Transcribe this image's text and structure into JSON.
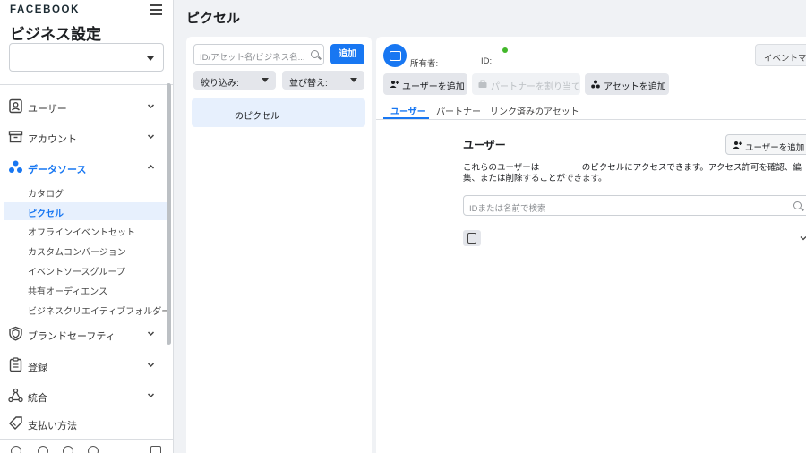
{
  "sidebar": {
    "brand": "FACEBOOK",
    "title": "ビジネス設定",
    "business_select_value": "",
    "items": [
      {
        "label": "ユーザー",
        "icon": "user-badge-icon"
      },
      {
        "label": "アカウント",
        "icon": "archive-box-icon"
      },
      {
        "label": "データソース",
        "icon": "nodes-icon"
      },
      {
        "label": "ブランドセーフティ",
        "icon": "shield-icon"
      },
      {
        "label": "登録",
        "icon": "clipboard-icon"
      },
      {
        "label": "統合",
        "icon": "integration-icon"
      },
      {
        "label": "支払い方法",
        "icon": "tag-icon"
      }
    ],
    "sub_items": [
      "カタログ",
      "ピクセル",
      "オフラインイベントセット",
      "カスタムコンバージョン",
      "イベントソースグループ",
      "共有オーディエンス",
      "ビジネスクリエイティブフォルダー"
    ]
  },
  "main": {
    "page_title": "ピクセル",
    "list": {
      "search_placeholder": "ID/アセット名/ビジネス名...",
      "add_button": "追加",
      "filter_label": "絞り込み:",
      "sort_label": "並び替え:",
      "items": [
        "のピクセル"
      ]
    },
    "detail": {
      "owner_label": "所有者:",
      "id_label": "ID:",
      "event_button": "イベントマ",
      "add_user_button": "ユーザーを追加",
      "assign_partner_button": "パートナーを割り当て",
      "add_asset_button": "アセットを追加",
      "tabs": [
        "ユーザー",
        "パートナー",
        "リンク済みのアセット"
      ],
      "section_title": "ユーザー",
      "section_add_user_button": "ユーザーを追加",
      "description": "これらのユーザーは　　　　　のピクセルにアクセスできます。アクセス許可を確認、編集、または削除することができます。",
      "user_search_placeholder": "IDまたは名前で検索"
    }
  },
  "colors": {
    "accent": "#1877f2",
    "selected_bg": "#e7f0fd",
    "status_green": "#42b72a"
  }
}
